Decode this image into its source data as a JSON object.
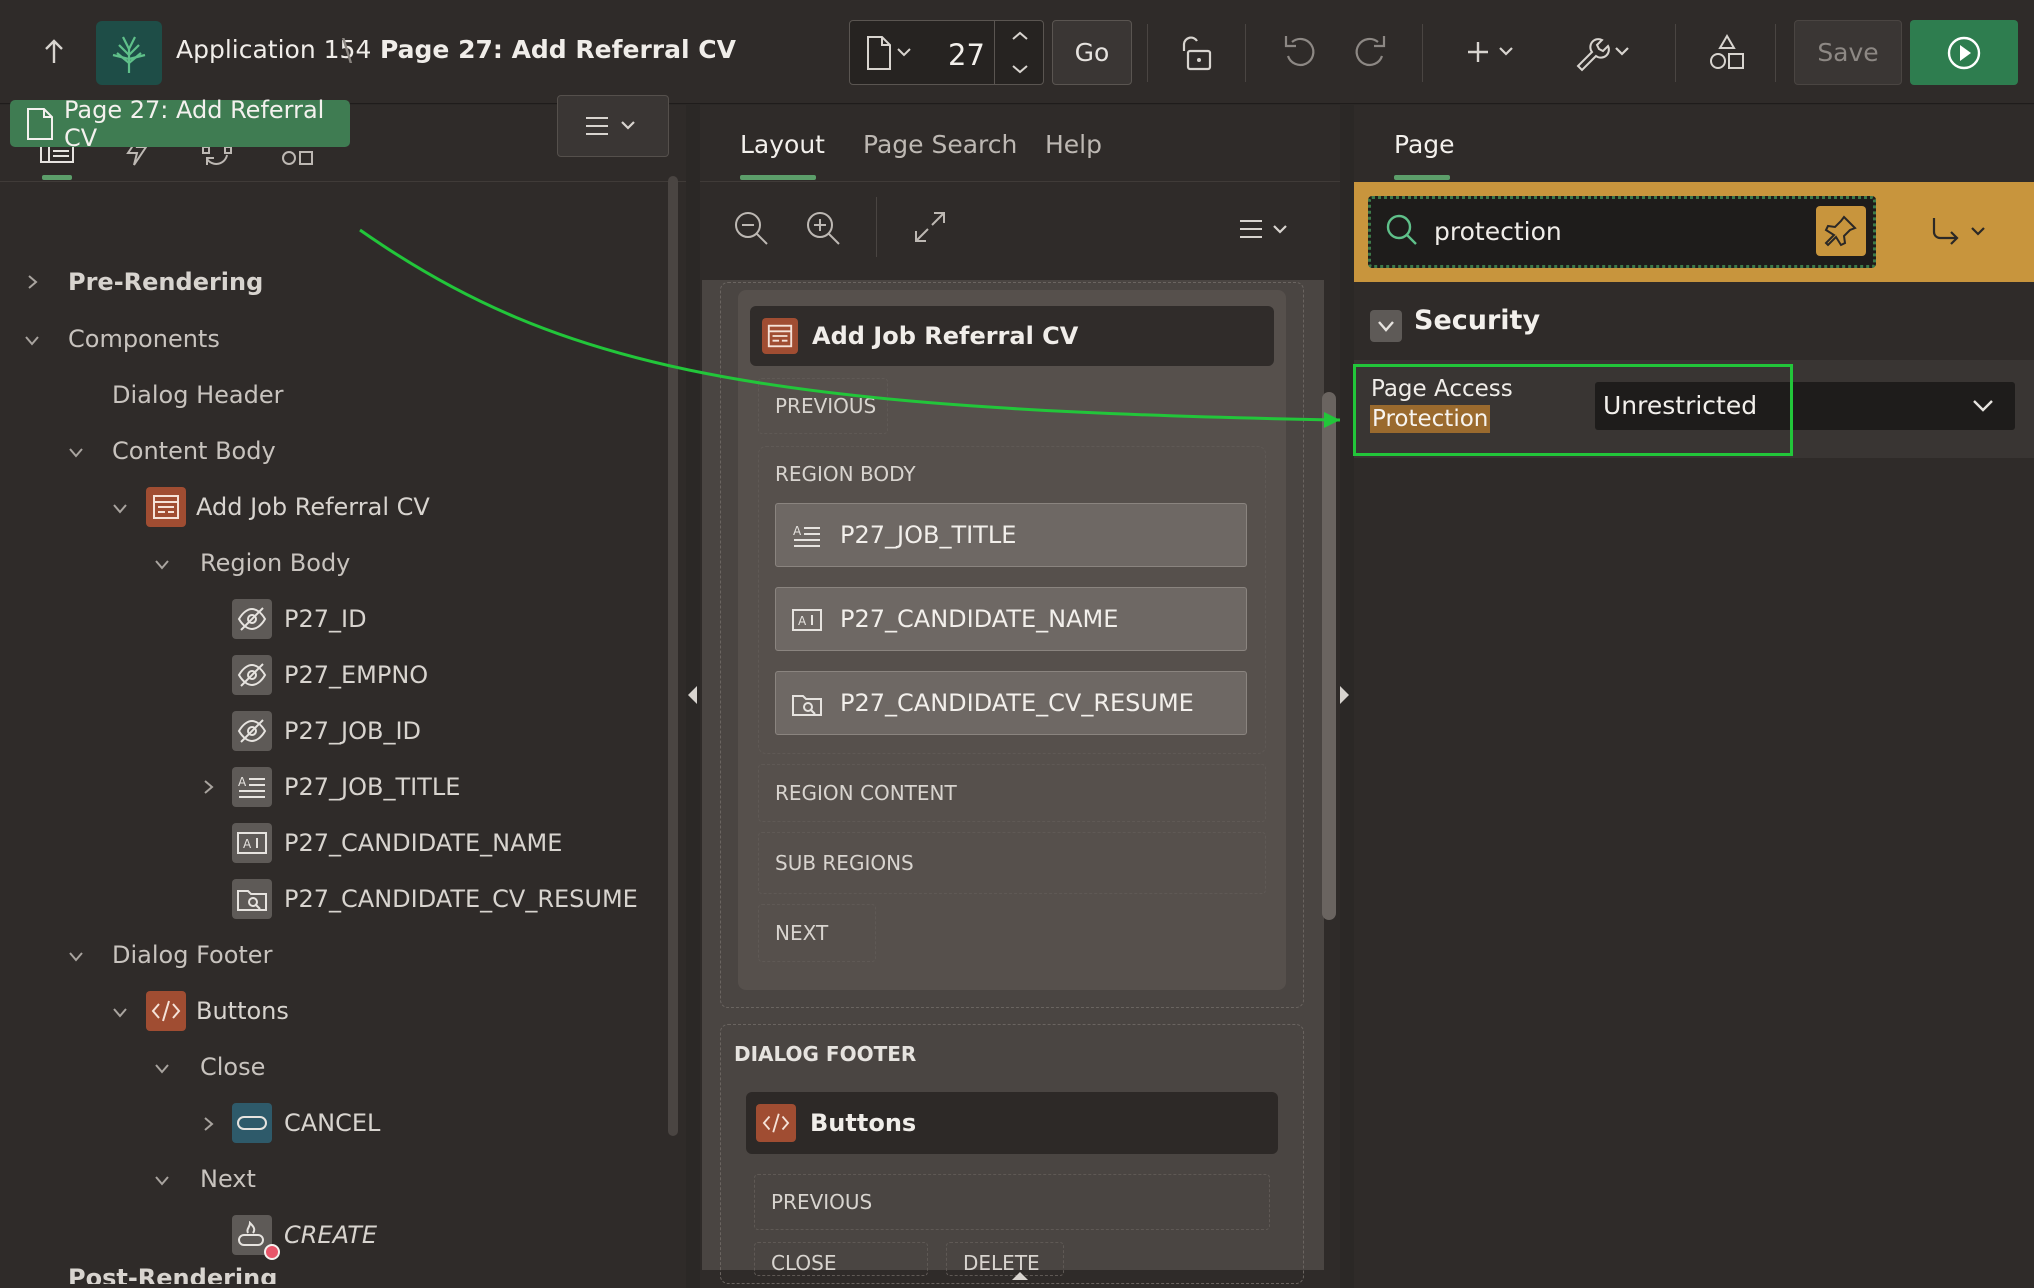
{
  "header": {
    "app_name": "Application 154",
    "separator": "\\",
    "page_title": "Page 27: Add Referral CV",
    "page_number": "27",
    "go_label": "Go",
    "save_label": "Save"
  },
  "left_panel": {
    "tabs": [
      "rendering-tree",
      "dynamic-actions",
      "processing",
      "shared-components"
    ],
    "page_node": "Page 27: Add Referral CV",
    "tree": {
      "pre_rendering": "Pre-Rendering",
      "components": "Components",
      "dialog_header": "Dialog Header",
      "content_body": "Content Body",
      "region": "Add Job Referral CV",
      "region_body": "Region Body",
      "items": [
        "P27_ID",
        "P27_EMPNO",
        "P27_JOB_ID",
        "P27_JOB_TITLE",
        "P27_CANDIDATE_NAME",
        "P27_CANDIDATE_CV_RESUME"
      ],
      "dialog_footer": "Dialog Footer",
      "buttons": "Buttons",
      "close": "Close",
      "cancel": "CANCEL",
      "next": "Next",
      "create": "CREATE",
      "post_rendering": "Post-Rendering"
    }
  },
  "center_panel": {
    "tabs": [
      "Layout",
      "Page Search",
      "Help"
    ],
    "region_title": "Add Job Referral CV",
    "slots": {
      "previous": "PREVIOUS",
      "region_body": "REGION BODY",
      "region_content": "REGION CONTENT",
      "sub_regions": "SUB REGIONS",
      "next": "NEXT",
      "dialog_footer": "DIALOG FOOTER",
      "buttons": "Buttons",
      "footer_previous": "PREVIOUS",
      "close": "CLOSE",
      "delete": "DELETE"
    },
    "layout_items": [
      "P27_JOB_TITLE",
      "P27_CANDIDATE_NAME",
      "P27_CANDIDATE_CV_RESUME"
    ]
  },
  "right_panel": {
    "tab": "Page",
    "search_value": "protection",
    "section": "Security",
    "property_label_1": "Page Access",
    "property_label_2": "Protection",
    "property_value": "Unrestricted"
  },
  "colors": {
    "accent_green": "#3f7c52",
    "highlight_green": "#22c63a",
    "search_band": "#c8953d",
    "run_button": "#2e7d4f"
  }
}
